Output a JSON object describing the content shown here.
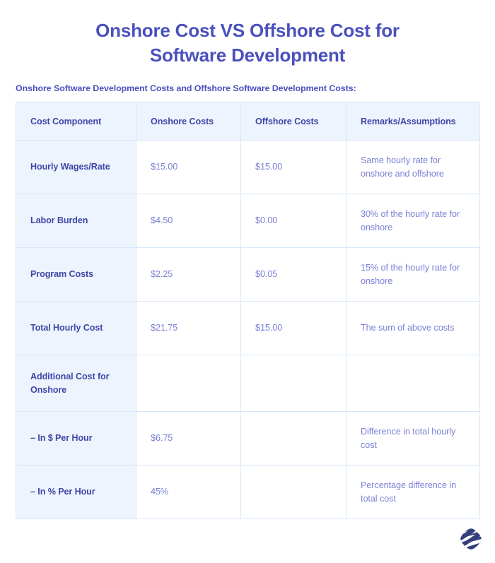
{
  "title": {
    "line1": "Onshore Cost VS Offshore Cost for",
    "line2": "Software Development",
    "color": "#4a50bd"
  },
  "subtitle": "Onshore Software Development Costs and Offshore Software Development Costs:",
  "table": {
    "columns": [
      "Cost Component",
      "Onshore Costs",
      "Offshore Costs",
      "Remarks/Assumptions"
    ],
    "rows": [
      {
        "component": "Hourly Wages/Rate",
        "onshore": "$15.00",
        "offshore": "$15.00",
        "remarks": "Same hourly rate for onshore and offshore"
      },
      {
        "component": "Labor Burden",
        "onshore": "$4.50",
        "offshore": "$0.00",
        "remarks": "30% of the hourly rate for onshore"
      },
      {
        "component": "Program Costs",
        "onshore": "$2.25",
        "offshore": "$0.05",
        "remarks": "15% of the hourly rate for onshore"
      },
      {
        "component": "Total Hourly Cost",
        "onshore": "$21.75",
        "offshore": "$15.00",
        "remarks": "The sum of above costs"
      },
      {
        "component": "Additional Cost for Onshore",
        "onshore": "",
        "offshore": "",
        "remarks": ""
      },
      {
        "component": "– In $ Per Hour",
        "onshore": "$6.75",
        "offshore": "",
        "remarks": "Difference in total hourly cost"
      },
      {
        "component": "– In % Per Hour",
        "onshore": "45%",
        "offshore": "",
        "remarks": "Percentage difference in total cost"
      }
    ]
  },
  "theme": {
    "page_background": "#ffffff",
    "heading_text": "#3f47a8",
    "value_text": "#7b80d6",
    "tint_cell": "#eef4fd",
    "border": "#d9e6fa",
    "logo_color": "#343f7a"
  },
  "logo": {
    "icon": "company-monogram-icon"
  }
}
